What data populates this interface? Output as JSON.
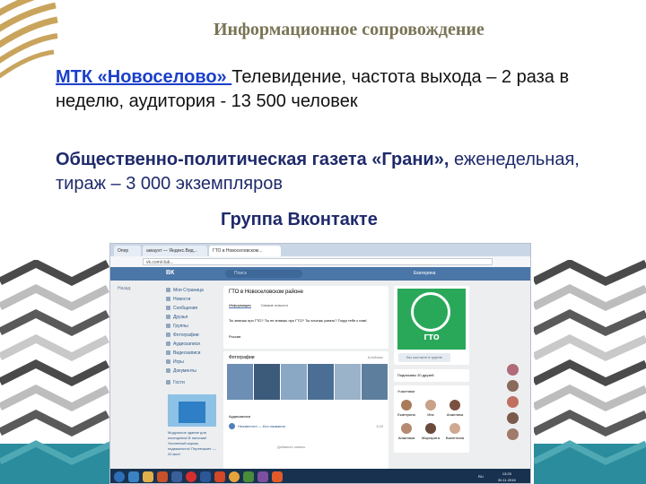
{
  "title": "Информационное сопровождение",
  "tv": {
    "link": "МТК «Новоселово» ",
    "text": "Телевидение, частота выхода – 2 раза в неделю,  аудитория - 13 500 человек"
  },
  "newspaper": {
    "bold": "Общественно-политическая газета «Грани»,",
    "rest": " еженедельная,  тираж – 3 000 экземпляров"
  },
  "vk_caption": "Группа Вконтакте",
  "colors": {
    "title": "#7a7456",
    "link": "#1a3fc9",
    "accent_text": "#1f2a6b",
    "vk_blue": "#4a76a8",
    "gto_green": "#2aa85a",
    "gold": "#c9a45c",
    "teal": "#2a8c9c"
  },
  "screenshot": {
    "tabs": [
      "Опер",
      "аккаунт — Яндекс.Вид...",
      "ГТО в Новоселовском..."
    ],
    "address": "vk.com/club...",
    "vk_logo": "ВК",
    "search_placeholder": "Поиск",
    "user_name": "Екатерина",
    "back_label": "Назад",
    "menu": [
      "Моя Страница",
      "Новости",
      "Сообщения",
      "Друзья",
      "Группы",
      "Фотографии",
      "Аудиозаписи",
      "Видеозаписи",
      "Игры",
      "Документы",
      "Гости"
    ],
    "ad_text": "Модульное здание для посещения! В наличии! Усиленный каркас, подвижность! Переезжает — 20 мин!",
    "group_name": "ГТО в Новоселовском районе",
    "group_tabs": [
      "Информация",
      "Свежие новости"
    ],
    "group_desc": "Ты знаешь про ГТО? Ты не знаешь про ГТО? Ты хочешь узнать? Тогда тебе к нам!",
    "group_location": "Россия",
    "photos_label": "Фотографии",
    "photos_all": "Альбомы",
    "audio_label": "Аудиозаписи",
    "audio_track": "Неизвестен — Без названия",
    "audio_time": "3:29",
    "add_audio": "Добавить запись",
    "gto_logo_text": "ГТО",
    "subscribe_button": "Вы состоите в группе",
    "friends_label": "Подписаны 20 друзей",
    "members_label": "Участники",
    "members": [
      "Екатерина",
      "Ина",
      "Анжелика",
      "Анжелика",
      "Маргарита",
      "Валентина"
    ],
    "language": "RU",
    "clock_time": "13:25",
    "clock_date": "30.11.2016"
  }
}
